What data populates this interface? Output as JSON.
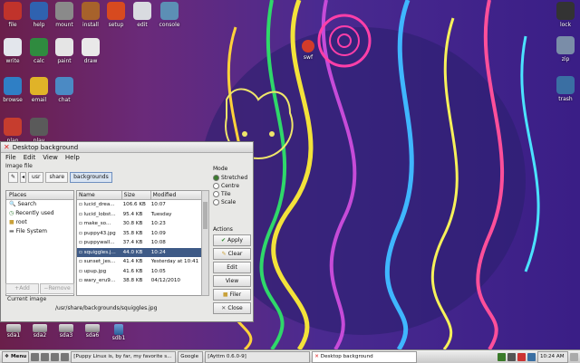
{
  "desktop_icons": [
    {
      "label": "file",
      "color": "#c0332b",
      "name": "file-icon"
    },
    {
      "label": "help",
      "color": "#2f62b0",
      "name": "help-icon"
    },
    {
      "label": "mount",
      "color": "#8a8a8a",
      "name": "mount-icon"
    },
    {
      "label": "install",
      "color": "#a7622b",
      "name": "install-icon"
    },
    {
      "label": "setup",
      "color": "#d74a1f",
      "name": "setup-icon"
    },
    {
      "label": "edit",
      "color": "#d9dbe0",
      "name": "edit-icon"
    },
    {
      "label": "console",
      "color": "#5c8fb5",
      "name": "console-icon"
    },
    {
      "label": "write",
      "color": "#e3e6ec",
      "name": "write-icon"
    },
    {
      "label": "calc",
      "color": "#2f8b3f",
      "name": "calc-icon"
    },
    {
      "label": "paint",
      "color": "#e5e5e5",
      "name": "paint-icon"
    },
    {
      "label": "draw",
      "color": "#e9e9e9",
      "name": "draw-icon"
    },
    {
      "label": "browse",
      "color": "#2f7fc5",
      "name": "browse-icon"
    },
    {
      "label": "email",
      "color": "#e0b328",
      "name": "email-icon"
    },
    {
      "label": "chat",
      "color": "#4b8ac4",
      "name": "chat-icon"
    },
    {
      "label": "plan",
      "color": "#c63d2e",
      "name": "plan-icon"
    },
    {
      "label": "play",
      "color": "#5a5a5a",
      "name": "play-icon"
    },
    {
      "label": "lock",
      "color": "#333333",
      "name": "lock-icon"
    },
    {
      "label": "zip",
      "color": "#7a8da8",
      "name": "zip-icon"
    },
    {
      "label": "trash",
      "color": "#3a6fa3",
      "name": "trash-icon"
    },
    {
      "label": "swf",
      "color": "#d23b2a",
      "name": "swf-icon"
    }
  ],
  "window": {
    "title": "Desktop background",
    "menu": [
      "File",
      "Edit",
      "View",
      "Help"
    ],
    "image_file_label": "Image file",
    "breadcrumbs": [
      "usr",
      "share",
      "backgrounds"
    ],
    "places_header": "Places",
    "places": [
      "Search",
      "Recently used",
      "root",
      "File System"
    ],
    "places_add": "Add",
    "places_remove": "Remove",
    "columns": {
      "name": "Name",
      "size": "Size",
      "modified": "Modified"
    },
    "files": [
      {
        "name": "lucid_drea...",
        "size": "106.6 KB",
        "modified": "10:07",
        "selected": false
      },
      {
        "name": "lucid_lobst...",
        "size": "95.4 KB",
        "modified": "Tuesday",
        "selected": false
      },
      {
        "name": "make_so...",
        "size": "30.8 KB",
        "modified": "10:23",
        "selected": false
      },
      {
        "name": "puppy43.jpg",
        "size": "35.8 KB",
        "modified": "10:09",
        "selected": false
      },
      {
        "name": "puppywall...",
        "size": "37.4 KB",
        "modified": "10:08",
        "selected": false
      },
      {
        "name": "squiggles.j...",
        "size": "44.0 KB",
        "modified": "10:24",
        "selected": true
      },
      {
        "name": "sunset_jes...",
        "size": "41.4 KB",
        "modified": "Yesterday at 10:41",
        "selected": false
      },
      {
        "name": "upup.jpg",
        "size": "41.6 KB",
        "modified": "10:05",
        "selected": false
      },
      {
        "name": "wary_eru9...",
        "size": "38.8 KB",
        "modified": "04/12/2010",
        "selected": false
      }
    ],
    "mode_label": "Mode",
    "modes": [
      {
        "label": "Stretched",
        "selected": true
      },
      {
        "label": "Centre",
        "selected": false
      },
      {
        "label": "Tile",
        "selected": false
      },
      {
        "label": "Scale",
        "selected": false
      }
    ],
    "actions_label": "Actions",
    "actions": [
      {
        "label": "Apply",
        "icon": "check-icon"
      },
      {
        "label": "Clear",
        "icon": "clear-icon"
      },
      {
        "label": "Edit",
        "icon": ""
      },
      {
        "label": "View",
        "icon": ""
      },
      {
        "label": "Filer",
        "icon": "folder-icon"
      },
      {
        "label": "Close",
        "icon": "close-icon"
      }
    ],
    "current_image_label": "Current image",
    "current_image_path": "/usr/share/backgrounds/squiggles.jpg"
  },
  "drives": [
    "sda1",
    "sda2",
    "sda3",
    "sda6",
    "sdb1"
  ],
  "taskbar": {
    "menu": "Menu",
    "tasks": [
      "[Puppy Linux is, by far, my favorite s...",
      "Google",
      "[Ayttm 0.6.0-9]",
      "Desktop background"
    ],
    "clock": "10:24 AM"
  }
}
